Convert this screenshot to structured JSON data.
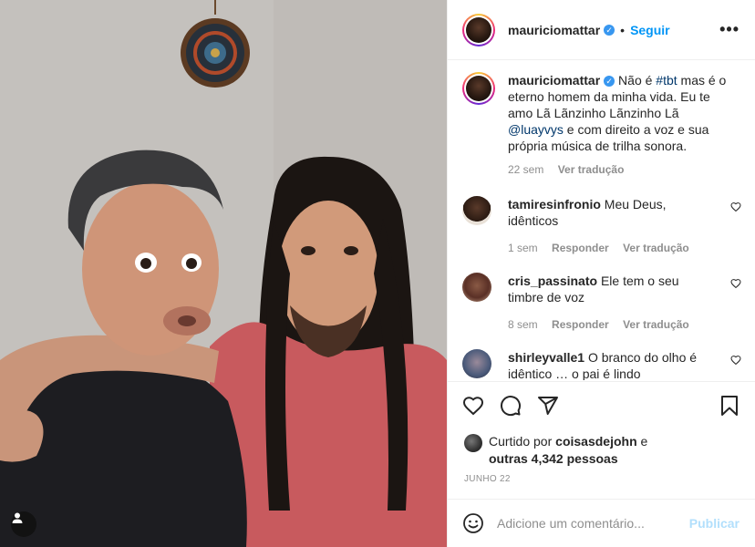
{
  "post": {
    "username": "mauriciomattar",
    "verified": true,
    "follow_label": "Seguir",
    "dot": "•",
    "more_label": "•••",
    "caption": {
      "prefix": "Não é ",
      "hashtag": "#tbt",
      "middle": " mas é o eterno homem da minha vida. Eu te amo Lã Lãnzinho Lãnzinho Lã ",
      "mention": "@luayvys",
      "suffix": " e com direito a voz e sua própria música de trilha sonora.",
      "time": "22 sem",
      "translate": "Ver tradução"
    }
  },
  "comments": [
    {
      "user": "tamiresinfronio",
      "text": "Meu Deus, idênticos",
      "time": "1 sem",
      "reply": "Responder",
      "translate": "Ver tradução",
      "avatar_color": "#3b2a22"
    },
    {
      "user": "cris_passinato",
      "text": "Ele tem o seu timbre de voz",
      "time": "8 sem",
      "reply": "Responder",
      "translate": "Ver tradução",
      "avatar_color": "#7a4a3a"
    },
    {
      "user": "shirleyvalle1",
      "text": "O branco do olho é idêntico … o pai é lindo",
      "time": "",
      "reply": "",
      "translate": "",
      "avatar_color": "#4a5a7a"
    }
  ],
  "likes": {
    "prefix": "Curtido por",
    "user": "coisasdejohn",
    "and": "e",
    "others": "outras 4,342 pessoas"
  },
  "date": "JUNHO 22",
  "add_comment": {
    "placeholder": "Adicione um comentário...",
    "publish_label": "Publicar"
  },
  "icons": {
    "like": "heart-icon",
    "comment": "comment-icon",
    "share": "share-icon",
    "save": "bookmark-icon",
    "emoji": "emoji-icon",
    "tag": "user-tag-icon"
  },
  "colors": {
    "accent": "#0095f6",
    "publish_disabled": "#b2dffc",
    "muted": "#8e8e8e",
    "link": "#00376b"
  }
}
